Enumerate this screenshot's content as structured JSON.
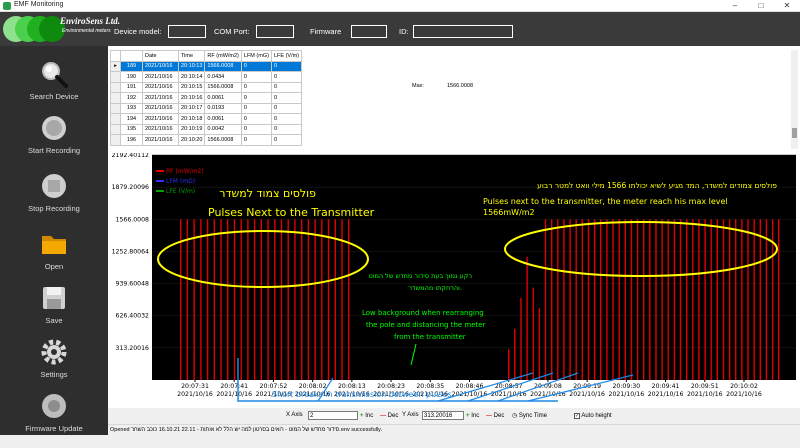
{
  "window": {
    "title": "EMF Monitoring"
  },
  "logo": {
    "name": "EnviroSens Ltd.",
    "tagline": "Environmental meters"
  },
  "header": {
    "device_model_label": "Device model:",
    "com_port_label": "COM Port:",
    "firmware_label": "Firmware",
    "id_label": "ID:",
    "device_model_value": "",
    "com_port_value": "",
    "firmware_value": "",
    "id_value": ""
  },
  "sidebar": {
    "items": [
      {
        "label": "Search Device",
        "icon": "magnifier-icon"
      },
      {
        "label": "Start Recording",
        "icon": "record-icon"
      },
      {
        "label": "Stop Recording",
        "icon": "stop-icon"
      },
      {
        "label": "Open",
        "icon": "folder-icon"
      },
      {
        "label": "Save",
        "icon": "floppy-icon"
      },
      {
        "label": "Settings",
        "icon": "gear-icon"
      },
      {
        "label": "Firmware Update",
        "icon": "firmware-icon"
      }
    ]
  },
  "grid": {
    "columns": [
      "Date",
      "Time",
      "RF (mW/m2)",
      "LFM (mG)",
      "LFE (V/m)"
    ],
    "rows": [
      {
        "idx": "189",
        "date": "2021/10/16",
        "time": "20:10:13",
        "rf": "1566.0008",
        "lfm": "0",
        "lfe": "0",
        "selected": true
      },
      {
        "idx": "190",
        "date": "2021/10/16",
        "time": "20:10:14",
        "rf": "0.0434",
        "lfm": "0",
        "lfe": "0"
      },
      {
        "idx": "191",
        "date": "2021/10/16",
        "time": "20:10:15",
        "rf": "1566.0008",
        "lfm": "0",
        "lfe": "0"
      },
      {
        "idx": "192",
        "date": "2021/10/16",
        "time": "20:10:16",
        "rf": "0.0061",
        "lfm": "0",
        "lfe": "0"
      },
      {
        "idx": "193",
        "date": "2021/10/16",
        "time": "20:10:17",
        "rf": "0.0193",
        "lfm": "0",
        "lfe": "0"
      },
      {
        "idx": "194",
        "date": "2021/10/16",
        "time": "20:10:18",
        "rf": "0.0061",
        "lfm": "0",
        "lfe": "0"
      },
      {
        "idx": "195",
        "date": "2021/10/16",
        "time": "20:10:19",
        "rf": "0.0042",
        "lfm": "0",
        "lfe": "0"
      },
      {
        "idx": "196",
        "date": "2021/10/16",
        "time": "20:10:20",
        "rf": "1566.0008",
        "lfm": "0",
        "lfe": "0"
      }
    ]
  },
  "max": {
    "label": "Max:",
    "value": "1566.0008"
  },
  "chart_data": {
    "type": "bar",
    "legend": [
      "RF (mW/m2)",
      "LFM (mG)",
      "LFE (V/m)"
    ],
    "legend_colors": [
      "#e00000",
      "#3030ff",
      "#00a000"
    ],
    "y_ticks": [
      "2192.40112",
      "1879.20096",
      "1566.0008",
      "1252.80064",
      "939.60048",
      "626.40032",
      "313.20016"
    ],
    "ylim": [
      0,
      2192.40112
    ],
    "x_ticks": [
      {
        "time": "20:07:31",
        "date": "2021/10/16"
      },
      {
        "time": "20:07:41",
        "date": "2021/10/16"
      },
      {
        "time": "20:07:52",
        "date": "2021/10/16"
      },
      {
        "time": "20:08:02",
        "date": "2021/10/16"
      },
      {
        "time": "20:08:13",
        "date": "2021/10/16"
      },
      {
        "time": "20:08:23",
        "date": "2021/10/16"
      },
      {
        "time": "20:08:35",
        "date": "2021/10/16"
      },
      {
        "time": "20:08:46",
        "date": "2021/10/16"
      },
      {
        "time": "20:08:57",
        "date": "2021/10/16"
      },
      {
        "time": "20:09:08",
        "date": "2021/10/16"
      },
      {
        "time": "20:09:19",
        "date": "2021/10/16"
      },
      {
        "time": "20:09:30",
        "date": "2021/10/16"
      },
      {
        "time": "20:09:41",
        "date": "2021/10/16"
      },
      {
        "time": "20:09:51",
        "date": "2021/10/16"
      },
      {
        "time": "20:10:02",
        "date": "2021/10/16"
      }
    ],
    "series": [
      {
        "name": "RF (mW/m2)",
        "color": "#e00000",
        "values": [
          1566,
          1566,
          1566,
          1566,
          1566,
          1566,
          1566,
          1566,
          1566,
          1566,
          1566,
          1566,
          1566,
          1566,
          1566,
          1566,
          1566,
          1566,
          1566,
          1566,
          1566,
          1566,
          1566,
          1566,
          1566,
          1566,
          300,
          500,
          800,
          1200,
          900,
          700,
          1566,
          1566,
          1566,
          1566,
          1566,
          1566,
          1566,
          1566,
          1566,
          1566,
          1566,
          1566,
          1566,
          1566,
          1566,
          1566,
          1566,
          1566,
          1566,
          1566,
          1566,
          1566,
          1566,
          1566,
          1566,
          1566,
          1566,
          1566,
          1566,
          1566,
          1566,
          1566,
          1566,
          1566,
          1566,
          1566,
          1566,
          1566,
          1566
        ]
      }
    ]
  },
  "annotations": {
    "left_hebrew": "פולסים צמוד למשדר",
    "left_english": "Pulses Next to the Transmitter",
    "right_hebrew": "פולסים צמודים למשדר, המד מגיע לשיא יכולתו 1566 מילי וואט למטר רבוע",
    "right_english_1": "Pulses next to the transmitter, the meter reach his max level",
    "right_english_2": "1566mW/m2",
    "mid_hebrew_1": "רקע נמוך בעת סידור מחדש של המוט",
    "mid_hebrew_2": "והרחקתו מהמשדר.",
    "low_bg_1": "Low background when rearranging",
    "low_bg_2": "the pole and distancing the meter",
    "low_bg_3": "from the transmitter",
    "short_breaks": "Short breaks in transmission between pulses"
  },
  "toolbar": {
    "x_axis_label": "X Axis",
    "x_axis_value": "2",
    "y_axis_label": "Y Axis",
    "y_axis_value": "313.20016",
    "inc_label": "Inc",
    "dec_label": "Dec",
    "sync_time_label": "Sync Time",
    "auto_height_label": "Auto height"
  },
  "status": {
    "text": "Opened סידור מחדש של המוט - רואים בסרטון למה יש הלל לא אותות - 22.11 16.10.21 כוכב השחר.env successfully."
  }
}
